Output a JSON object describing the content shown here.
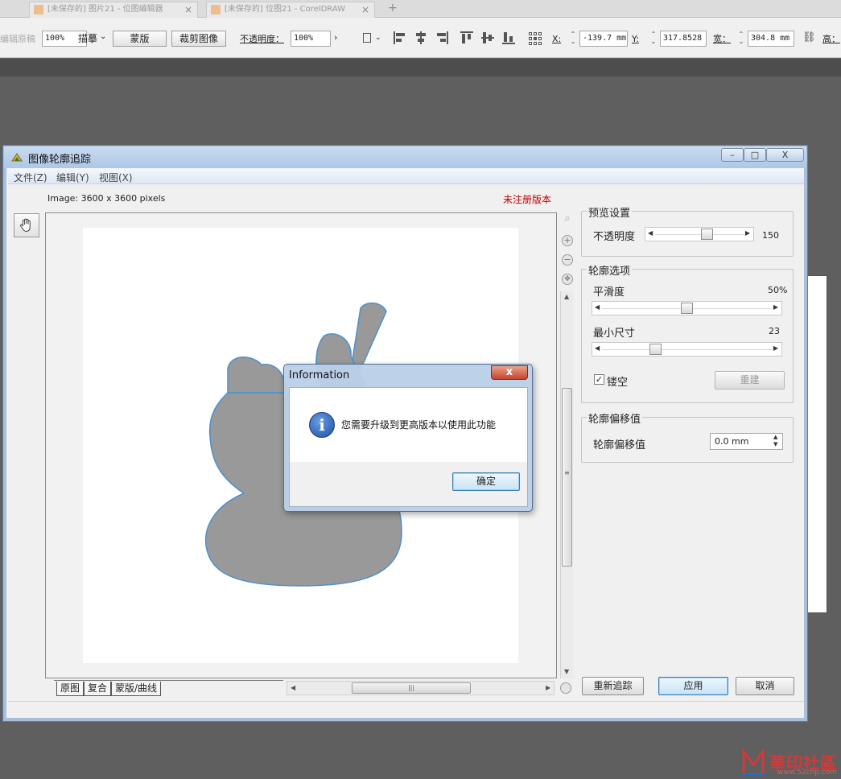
{
  "host": {
    "tabs": [
      {
        "label": "[未保存的] 图片21 - 位图编辑器"
      },
      {
        "label": "[未保存的] 位图21 - CorelDRAW"
      }
    ],
    "toolbar": {
      "left_faded": "编辑原稿",
      "zoom_value": "100%",
      "trace_label": "描摹",
      "mask_button": "蒙版",
      "crop_button": "裁剪图像",
      "opacity_label": "不透明度：",
      "opacity_value": "100%",
      "x_label": "X:",
      "x_value": "-139.7 mm",
      "y_label": "Y:",
      "y_value": "317.8528",
      "w_label": "宽：",
      "w_value": "304.8 mm",
      "h_label": "高："
    }
  },
  "dialog": {
    "title": "图像轮廓追踪",
    "window_buttons": {
      "minimize": "–",
      "maximize": "□",
      "close": "X"
    },
    "menu": [
      "文件(Z)",
      "编辑(Y)",
      "视图(X)"
    ],
    "image_info": "Image: 3600 x 3600 pixels",
    "unregistered": "未注册版本",
    "bottom_tabs": [
      "原图",
      "复合",
      "蒙版/曲线"
    ],
    "preview": {
      "group_title": "预览设置",
      "opacity_label": "不透明度",
      "opacity_value": "150",
      "opacity_fraction": 0.6
    },
    "contour": {
      "group_title": "轮廓选项",
      "smooth_label": "平滑度",
      "smooth_value": "50%",
      "smooth_fraction": 0.5,
      "minsize_label": "最小尺寸",
      "minsize_value": "23",
      "minsize_fraction": 0.3,
      "hollow_label": "镂空",
      "hollow_checked": true,
      "rebuild_button": "重建"
    },
    "offset": {
      "group_title": "轮廓偏移值",
      "label": "轮廓偏移值",
      "value": "0.0 mm"
    },
    "buttons": {
      "retrace": "重新追踪",
      "apply": "应用",
      "cancel": "取消"
    }
  },
  "message_box": {
    "title": "Information",
    "close": "x",
    "text": "您需要升级到更高版本以使用此功能",
    "ok_button": "确定"
  },
  "watermark": {
    "brand": "華印社區",
    "url": "www.52cnp.com"
  },
  "colors": {
    "unregistered": "#c00000",
    "shape_fill": "#999999",
    "shape_outline": "#4a90d0"
  }
}
